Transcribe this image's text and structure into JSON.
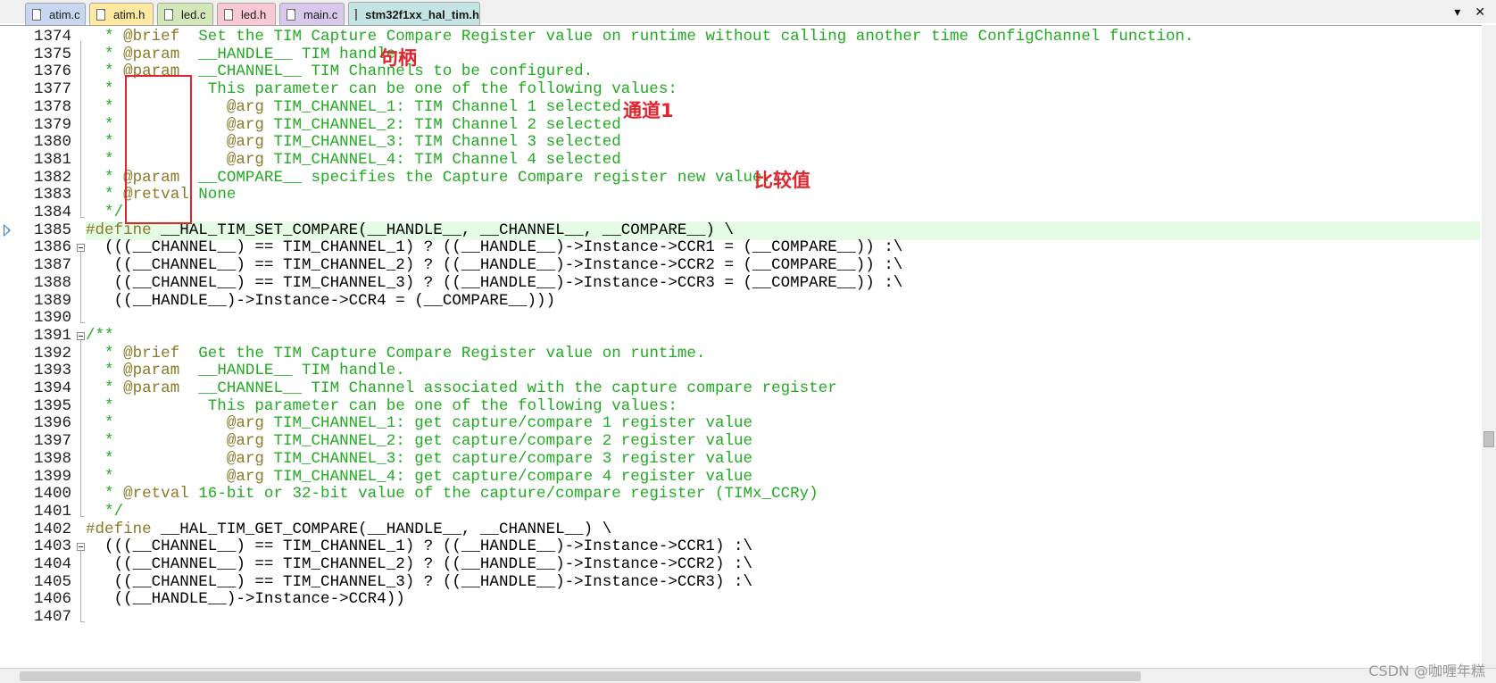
{
  "tabs": [
    {
      "label": "atim.c",
      "color": "#c9d6f0",
      "icon": "c-file-icon",
      "active": false
    },
    {
      "label": "atim.h",
      "color": "#ffe8a0",
      "icon": "h-file-icon",
      "active": false
    },
    {
      "label": "led.c",
      "color": "#d3e8b8",
      "icon": "c-file-icon",
      "active": false
    },
    {
      "label": "led.h",
      "color": "#f8c8d4",
      "icon": "h-file-icon",
      "active": false
    },
    {
      "label": "main.c",
      "color": "#d8c8ec",
      "icon": "c-file-icon",
      "active": false
    },
    {
      "label": "stm32f1xx_hal_tim.h",
      "color": "#c4e4e4",
      "icon": "h-file-icon",
      "active": true
    }
  ],
  "tab_controls": {
    "dropdown": "▾",
    "close": "✕"
  },
  "current_line": 1385,
  "lines": [
    {
      "n": "1374",
      "t": [
        [
          "com",
          "  * "
        ],
        [
          "tag",
          "@brief"
        ],
        [
          "com",
          "  Set the TIM Capture Compare Register value on runtime without calling another time ConfigChannel function."
        ]
      ]
    },
    {
      "n": "1375",
      "t": [
        [
          "com",
          "  * "
        ],
        [
          "tag",
          "@param"
        ],
        [
          "com",
          "  __HANDLE__ TIM handle."
        ]
      ]
    },
    {
      "n": "1376",
      "t": [
        [
          "com",
          "  * "
        ],
        [
          "tag",
          "@param"
        ],
        [
          "com",
          "  __CHANNEL__ TIM Channels to be configured."
        ]
      ]
    },
    {
      "n": "1377",
      "t": [
        [
          "com",
          "  *          This parameter can be one of the following values:"
        ]
      ]
    },
    {
      "n": "1378",
      "t": [
        [
          "com",
          "  *            "
        ],
        [
          "tag",
          "@arg"
        ],
        [
          "com",
          " TIM_CHANNEL_1: TIM Channel 1 selected"
        ]
      ]
    },
    {
      "n": "1379",
      "t": [
        [
          "com",
          "  *            "
        ],
        [
          "tag",
          "@arg"
        ],
        [
          "com",
          " TIM_CHANNEL_2: TIM Channel 2 selected"
        ]
      ]
    },
    {
      "n": "1380",
      "t": [
        [
          "com",
          "  *            "
        ],
        [
          "tag",
          "@arg"
        ],
        [
          "com",
          " TIM_CHANNEL_3: TIM Channel 3 selected"
        ]
      ]
    },
    {
      "n": "1381",
      "t": [
        [
          "com",
          "  *            "
        ],
        [
          "tag",
          "@arg"
        ],
        [
          "com",
          " TIM_CHANNEL_4: TIM Channel 4 selected"
        ]
      ]
    },
    {
      "n": "1382",
      "t": [
        [
          "com",
          "  * "
        ],
        [
          "tag",
          "@param"
        ],
        [
          "com",
          "  __COMPARE__ specifies the Capture Compare register new value."
        ]
      ]
    },
    {
      "n": "1383",
      "t": [
        [
          "com",
          "  * "
        ],
        [
          "tag",
          "@retval"
        ],
        [
          "com",
          " None"
        ]
      ]
    },
    {
      "n": "1384",
      "t": [
        [
          "com",
          "  */"
        ]
      ]
    },
    {
      "n": "1385",
      "t": [
        [
          "pp",
          "#define"
        ],
        [
          "def",
          " __HAL_TIM_SET_COMPARE(__HANDLE__, __CHANNEL__, __COMPARE__) \\"
        ]
      ]
    },
    {
      "n": "1386",
      "t": [
        [
          "def",
          "  (((__CHANNEL__) == TIM_CHANNEL_1) ? ((__HANDLE__)->Instance->CCR1 = (__COMPARE__)) :\\"
        ]
      ]
    },
    {
      "n": "1387",
      "t": [
        [
          "def",
          "   ((__CHANNEL__) == TIM_CHANNEL_2) ? ((__HANDLE__)->Instance->CCR2 = (__COMPARE__)) :\\"
        ]
      ]
    },
    {
      "n": "1388",
      "t": [
        [
          "def",
          "   ((__CHANNEL__) == TIM_CHANNEL_3) ? ((__HANDLE__)->Instance->CCR3 = (__COMPARE__)) :\\"
        ]
      ]
    },
    {
      "n": "1389",
      "t": [
        [
          "def",
          "   ((__HANDLE__)->Instance->CCR4 = (__COMPARE__)))"
        ]
      ]
    },
    {
      "n": "1390",
      "t": [
        [
          "def",
          ""
        ]
      ]
    },
    {
      "n": "1391",
      "t": [
        [
          "com",
          "/**"
        ]
      ]
    },
    {
      "n": "1392",
      "t": [
        [
          "com",
          "  * "
        ],
        [
          "tag",
          "@brief"
        ],
        [
          "com",
          "  Get the TIM Capture Compare Register value on runtime."
        ]
      ]
    },
    {
      "n": "1393",
      "t": [
        [
          "com",
          "  * "
        ],
        [
          "tag",
          "@param"
        ],
        [
          "com",
          "  __HANDLE__ TIM handle."
        ]
      ]
    },
    {
      "n": "1394",
      "t": [
        [
          "com",
          "  * "
        ],
        [
          "tag",
          "@param"
        ],
        [
          "com",
          "  __CHANNEL__ TIM Channel associated with the capture compare register"
        ]
      ]
    },
    {
      "n": "1395",
      "t": [
        [
          "com",
          "  *          This parameter can be one of the following values:"
        ]
      ]
    },
    {
      "n": "1396",
      "t": [
        [
          "com",
          "  *            "
        ],
        [
          "tag",
          "@arg"
        ],
        [
          "com",
          " TIM_CHANNEL_1: get capture/compare 1 register value"
        ]
      ]
    },
    {
      "n": "1397",
      "t": [
        [
          "com",
          "  *            "
        ],
        [
          "tag",
          "@arg"
        ],
        [
          "com",
          " TIM_CHANNEL_2: get capture/compare 2 register value"
        ]
      ]
    },
    {
      "n": "1398",
      "t": [
        [
          "com",
          "  *            "
        ],
        [
          "tag",
          "@arg"
        ],
        [
          "com",
          " TIM_CHANNEL_3: get capture/compare 3 register value"
        ]
      ]
    },
    {
      "n": "1399",
      "t": [
        [
          "com",
          "  *            "
        ],
        [
          "tag",
          "@arg"
        ],
        [
          "com",
          " TIM_CHANNEL_4: get capture/compare 4 register value"
        ]
      ]
    },
    {
      "n": "1400",
      "t": [
        [
          "com",
          "  * "
        ],
        [
          "tag",
          "@retval"
        ],
        [
          "com",
          " 16-bit or 32-bit value of the capture/compare register (TIMx_CCRy)"
        ]
      ]
    },
    {
      "n": "1401",
      "t": [
        [
          "com",
          "  */"
        ]
      ]
    },
    {
      "n": "1402",
      "t": [
        [
          "pp",
          "#define"
        ],
        [
          "def",
          " __HAL_TIM_GET_COMPARE(__HANDLE__, __CHANNEL__) \\"
        ]
      ]
    },
    {
      "n": "1403",
      "t": [
        [
          "def",
          "  (((__CHANNEL__) == TIM_CHANNEL_1) ? ((__HANDLE__)->Instance->CCR1) :\\"
        ]
      ]
    },
    {
      "n": "1404",
      "t": [
        [
          "def",
          "   ((__CHANNEL__) == TIM_CHANNEL_2) ? ((__HANDLE__)->Instance->CCR2) :\\"
        ]
      ]
    },
    {
      "n": "1405",
      "t": [
        [
          "def",
          "   ((__CHANNEL__) == TIM_CHANNEL_3) ? ((__HANDLE__)->Instance->CCR3) :\\"
        ]
      ]
    },
    {
      "n": "1406",
      "t": [
        [
          "def",
          "   ((__HANDLE__)->Instance->CCR4))"
        ]
      ]
    },
    {
      "n": "1407",
      "t": [
        [
          "def",
          ""
        ]
      ]
    }
  ],
  "annotations": {
    "handle_note": "句柄",
    "channel_note": "通道1",
    "compare_note": "比较值"
  },
  "watermark": "CSDN @咖喱年糕",
  "colors": {
    "comment": "#22aa22",
    "doc_tag": "#8a7a28",
    "annotation": "#e0262d",
    "current_line": "#e4fbe4"
  }
}
